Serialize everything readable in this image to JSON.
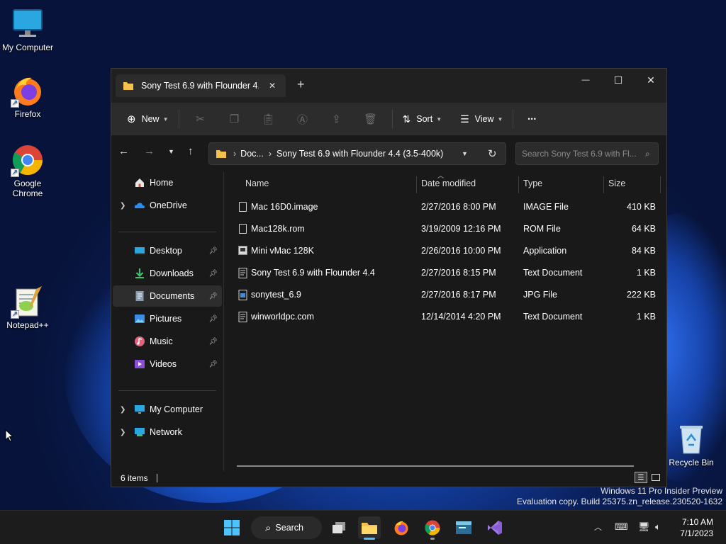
{
  "desktop": {
    "icons": [
      {
        "label": "My Computer"
      },
      {
        "label": "Firefox"
      },
      {
        "label": "Google Chrome"
      },
      {
        "label": "Notepad++"
      },
      {
        "label": "Recycle Bin"
      }
    ],
    "watermark": {
      "line1": "Windows 11 Pro Insider Preview",
      "line2": "Evaluation copy. Build 25375.zn_release.230520-1632"
    }
  },
  "window": {
    "tab_title": "Sony Test 6.9 with Flounder 4.4 (3.5-400k)",
    "new_tab_symbol": "+",
    "tab_close_symbol": "✕",
    "controls": {
      "minimize": "—",
      "maximize": "☐",
      "close": "✕"
    },
    "toolbar": {
      "new_label": "New",
      "sort_label": "Sort",
      "view_label": "View",
      "more_label": "•••"
    },
    "address": {
      "crumbs": [
        "Doc...",
        "Sony Test 6.9 with Flounder 4.4 (3.5-400k)"
      ],
      "search_placeholder": "Search Sony Test 6.9 with Fl..."
    },
    "sidebar": {
      "home": "Home",
      "onedrive": "OneDrive",
      "desktop": "Desktop",
      "downloads": "Downloads",
      "documents": "Documents",
      "pictures": "Pictures",
      "music": "Music",
      "videos": "Videos",
      "mycomputer": "My Computer",
      "network": "Network"
    },
    "columns": {
      "name": "Name",
      "date": "Date modified",
      "type": "Type",
      "size": "Size"
    },
    "files": [
      {
        "name": "Mac 16D0.image",
        "date": "2/27/2016 8:00 PM",
        "type": "IMAGE File",
        "size": "410 KB"
      },
      {
        "name": "Mac128k.rom",
        "date": "3/19/2009 12:16 PM",
        "type": "ROM File",
        "size": "64 KB"
      },
      {
        "name": "Mini vMac 128K",
        "date": "2/26/2016 10:00 PM",
        "type": "Application",
        "size": "84 KB"
      },
      {
        "name": "Sony Test 6.9 with Flounder 4.4",
        "date": "2/27/2016 8:15 PM",
        "type": "Text Document",
        "size": "1 KB"
      },
      {
        "name": "sonytest_6.9",
        "date": "2/27/2016 8:17 PM",
        "type": "JPG File",
        "size": "222 KB"
      },
      {
        "name": "winworldpc.com",
        "date": "12/14/2014 4:20 PM",
        "type": "Text Document",
        "size": "1 KB"
      }
    ],
    "status": {
      "count": "6 items"
    }
  },
  "taskbar": {
    "search_label": "Search",
    "time": "7:10 AM",
    "date": "7/1/2023"
  },
  "colors": {
    "accent": "#0078d4",
    "folder": "#f2c14e",
    "window_bg": "#191919"
  }
}
